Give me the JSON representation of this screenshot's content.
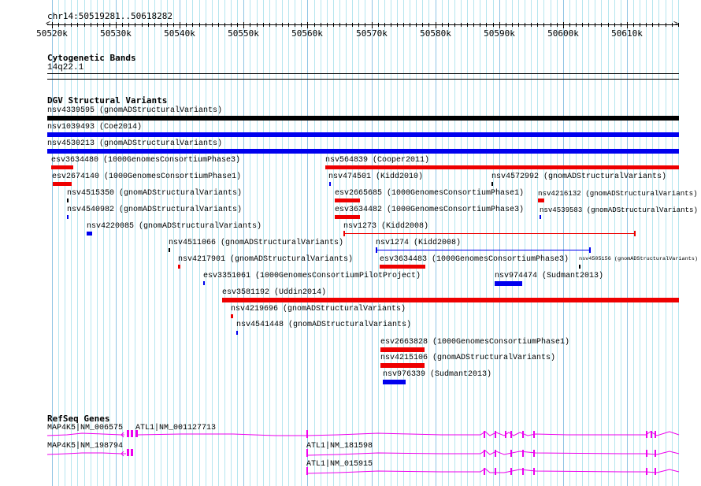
{
  "ruler": {
    "location": "chr14:50519281..50618282",
    "ticks": [
      "50520k",
      "50530k",
      "50540k",
      "50550k",
      "50560k",
      "50570k",
      "50580k",
      "50590k",
      "50600k",
      "50610k"
    ]
  },
  "tracks": {
    "cytoband": {
      "title": "Cytogenetic Bands",
      "band": "14q22.1"
    },
    "dgv": {
      "title": "DGV Structural Variants",
      "features": [
        {
          "label": "nsv4339595 (gnomADStructuralVariants)",
          "color": "#000000"
        },
        {
          "label": "nsv1039493 (Coe2014)",
          "color": "#0000ee"
        },
        {
          "label": "nsv4530213 (gnomADStructuralVariants)",
          "color": "#0000ee"
        },
        {
          "label": "esv3634480 (1000GenomesConsortiumPhase3)",
          "color": "#ee0000"
        },
        {
          "label": "nsv564839 (Cooper2011)",
          "color": "#ee0000"
        },
        {
          "label": "esv2674140 (1000GenomesConsortiumPhase1)",
          "color": "#ee0000"
        },
        {
          "label": "nsv474501 (Kidd2010)",
          "color": "#0000ee"
        },
        {
          "label": "nsv4572992 (gnomADStructuralVariants)",
          "color": "#000000"
        },
        {
          "label": "nsv4515350 (gnomADStructuralVariants)",
          "color": "#000000"
        },
        {
          "label": "esv2665685 (1000GenomesConsortiumPhase1)",
          "color": "#ee0000"
        },
        {
          "label": "nsv4216132 (gnomADStructuralVariants)",
          "color": "#ee0000"
        },
        {
          "label": "nsv4540982 (gnomADStructuralVariants)",
          "color": "#0000ee"
        },
        {
          "label": "esv3634482 (1000GenomesConsortiumPhase3)",
          "color": "#ee0000"
        },
        {
          "label": "nsv4539583 (gnomADStructuralVariants)",
          "color": "#0000ee"
        },
        {
          "label": "nsv4220085 (gnomADStructuralVariants)",
          "color": "#0000ee"
        },
        {
          "label": "nsv1273 (Kidd2008)",
          "color": "#ee0000"
        },
        {
          "label": "nsv4511066 (gnomADStructuralVariants)",
          "color": "#000000"
        },
        {
          "label": "nsv1274 (Kidd2008)",
          "color": "#0000ee"
        },
        {
          "label": "nsv4217901 (gnomADStructuralVariants)",
          "color": "#ee0000"
        },
        {
          "label": "esv3634483 (1000GenomesConsortiumPhase3)",
          "color": "#ee0000"
        },
        {
          "label": "nsv4505156 (gnomADStructuralVariants)",
          "color": "#000000"
        },
        {
          "label": "esv3351061 (1000GenomesConsortiumPilotProject)",
          "color": "#0000ee"
        },
        {
          "label": "nsv974474 (Sudmant2013)",
          "color": "#0000ee"
        },
        {
          "label": "esv3581192 (Uddin2014)",
          "color": "#ee0000"
        },
        {
          "label": "nsv4219696 (gnomADStructuralVariants)",
          "color": "#ee0000"
        },
        {
          "label": "nsv4541448 (gnomADStructuralVariants)",
          "color": "#0000ee"
        },
        {
          "label": "esv2663828 (1000GenomesConsortiumPhase1)",
          "color": "#ee0000"
        },
        {
          "label": "nsv4215106 (gnomADStructuralVariants)",
          "color": "#ee0000"
        },
        {
          "label": "nsv976339 (Sudmant2013)",
          "color": "#0000ee"
        }
      ]
    },
    "refseq": {
      "title": "RefSeq Genes",
      "color": "#ee00ee",
      "genes": [
        {
          "label": "MAP4K5|NM_006575"
        },
        {
          "label": "ATL1|NM_001127713"
        },
        {
          "label": "MAP4K5|NM_198794"
        },
        {
          "label": "ATL1|NM_181598"
        },
        {
          "label": "ATL1|NM_015915"
        }
      ]
    }
  }
}
